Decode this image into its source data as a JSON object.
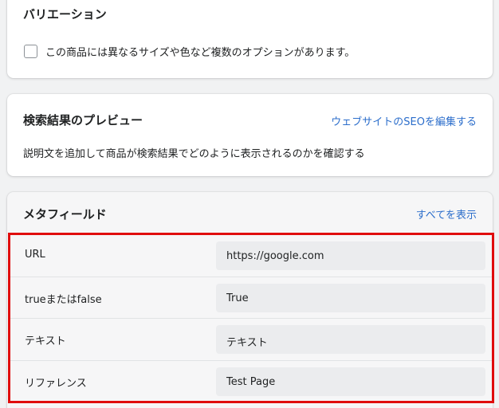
{
  "variations": {
    "title": "バリエーション",
    "option_label": "この商品には異なるサイズや色など複数のオプションがあります。"
  },
  "seo": {
    "title": "検索結果のプレビュー",
    "edit_link": "ウェブサイトのSEOを編集する",
    "description": "説明文を追加して商品が検索結果でどのように表示されるのかを確認する"
  },
  "metafields": {
    "title": "メタフィールド",
    "show_all_link": "すべてを表示",
    "rows": [
      {
        "label": "URL",
        "value": "https://google.com"
      },
      {
        "label": "trueまたはfalse",
        "value": "True"
      },
      {
        "label": "テキスト",
        "value": "テキスト"
      },
      {
        "label": "リファレンス",
        "value": "Test Page"
      }
    ]
  },
  "colors": {
    "link": "#2c6ecb",
    "highlight_border": "#e00d0d",
    "background": "#f1f2f3"
  }
}
